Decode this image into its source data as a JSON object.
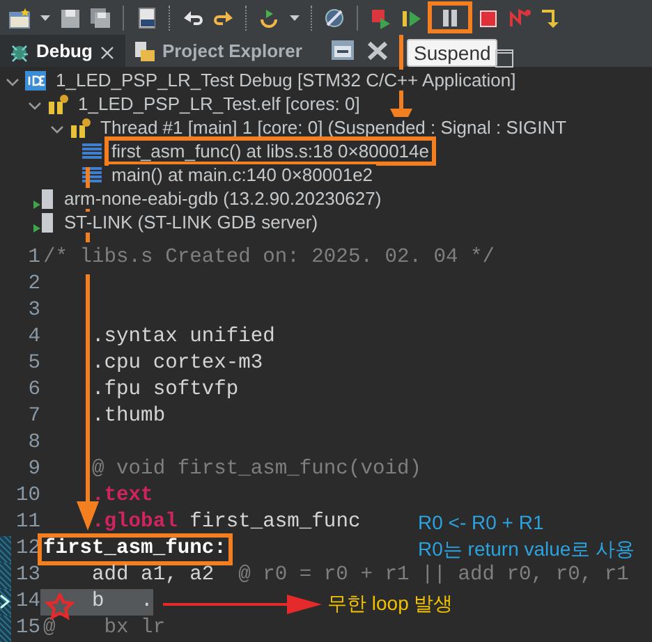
{
  "toolbar": {
    "suspend_boxed": true
  },
  "tooltip": {
    "text": "Suspend"
  },
  "tabs": [
    {
      "label": "Debug",
      "selected": true,
      "closable": true
    },
    {
      "label": "Project Explorer",
      "selected": false,
      "closable": false
    }
  ],
  "debug_tree": [
    {
      "kind": "launch",
      "label": "1_LED_PSP_LR_Test Debug [STM32 C/C++ Application]",
      "expanded": true,
      "children": [
        {
          "kind": "process",
          "label": "1_LED_PSP_LR_Test.elf [cores: 0]",
          "expanded": true,
          "children": [
            {
              "kind": "thread",
              "label": "Thread #1 [main] 1 [core: 0] (Suspended : Signal : SIGINT",
              "expanded": true,
              "children": [
                {
                  "kind": "frame",
                  "label": "first_asm_func() at libs.s:18 0×800014e",
                  "boxed": true
                },
                {
                  "kind": "frame",
                  "label": "main() at main.c:140 0×80001e2",
                  "boxed": false
                }
              ]
            }
          ]
        },
        {
          "kind": "tool",
          "label": "arm-none-eabi-gdb (13.2.90.20230627)"
        },
        {
          "kind": "tool",
          "label": "ST-LINK (ST-LINK GDB server)"
        }
      ]
    }
  ],
  "editor": {
    "lines": [
      {
        "number": "1",
        "segments": [
          {
            "kind": "comment",
            "text": "/* libs.s Created on: 2025. 02. 04 */"
          }
        ]
      },
      {
        "number": "2"
      },
      {
        "number": "3"
      },
      {
        "number": "4",
        "segments": [
          {
            "kind": "plain",
            "text": "    .syntax unified"
          }
        ]
      },
      {
        "number": "5",
        "segments": [
          {
            "kind": "plain",
            "text": "    .cpu cortex-m3"
          }
        ]
      },
      {
        "number": "6",
        "segments": [
          {
            "kind": "plain",
            "text": "    .fpu softvfp"
          }
        ]
      },
      {
        "number": "7",
        "segments": [
          {
            "kind": "plain",
            "text": "    .thumb"
          }
        ]
      },
      {
        "number": "8"
      },
      {
        "number": "9",
        "segments": [
          {
            "kind": "comment",
            "text": "    @ void first_asm_func(void)"
          }
        ]
      },
      {
        "number": "10",
        "segments": [
          {
            "kind": "keyword",
            "text": "    .text"
          }
        ]
      },
      {
        "number": "11",
        "segments": [
          {
            "kind": "keyword",
            "text": "    .global"
          },
          {
            "kind": "plain",
            "text": " first_asm_func"
          }
        ]
      },
      {
        "number": "12",
        "boxed": true,
        "range": true,
        "segments": [
          {
            "kind": "label",
            "text": "first_asm_func:"
          }
        ]
      },
      {
        "number": "13",
        "range": true,
        "segments": [
          {
            "kind": "plain",
            "text": "    add a1, a2"
          },
          {
            "kind": "comment",
            "text": "  @ r0 = r0 + r1 || add r0, r0, r1"
          }
        ]
      },
      {
        "number": "14",
        "range": true,
        "current": true,
        "starred": true,
        "segments": [
          {
            "kind": "plain",
            "text": "    b   ."
          }
        ]
      },
      {
        "number": "15",
        "range": true,
        "segments": [
          {
            "kind": "comment",
            "text": "@    bx lr"
          }
        ]
      }
    ]
  },
  "notes": [
    {
      "text": "R0 <- R0 + R1",
      "color": "#2ba3df"
    },
    {
      "text": "R0는 return value로 사용",
      "color": "#2ba3df"
    },
    {
      "text": "무한 loop 발생",
      "color": "#f2c200"
    }
  ]
}
